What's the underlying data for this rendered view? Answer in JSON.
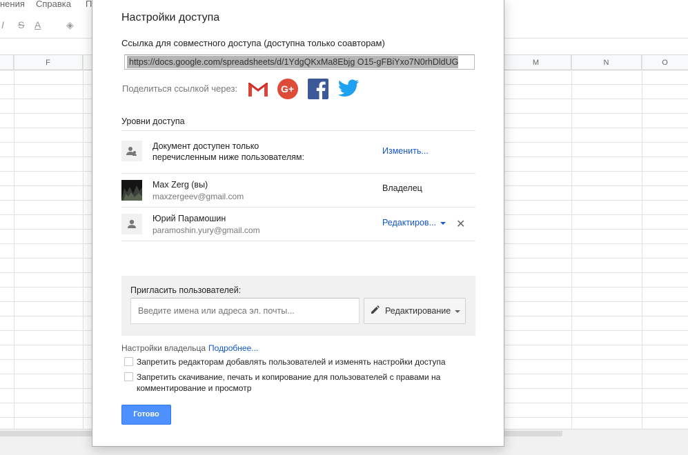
{
  "background": {
    "menu": [
      "нения",
      "Справка",
      "П"
    ],
    "columns": [
      "F",
      "M",
      "N",
      "O"
    ]
  },
  "dialog": {
    "title": "Настройки доступа",
    "link_label": "Ссылка для совместного доступа (доступна только соавторам)",
    "link_value": "https://docs.google.com/spreadsheets/d/1YdgQKxMa8Ebjg O15-gFBiYxo7N0rhDldUG",
    "share_label": "Поделиться ссылкой через:",
    "share_services": [
      "Gmail",
      "Google+",
      "Facebook",
      "Twitter"
    ],
    "access_title": "Уровни доступа",
    "access_rows": [
      {
        "text_line1": "Документ доступен только",
        "text_line2": "перечисленным ниже пользователям:",
        "action": "Изменить..."
      },
      {
        "name": "Max Zerg (вы)",
        "email": "maxzergeev@gmail.com",
        "role": "Владелец"
      },
      {
        "name": "Юрий Парамошин",
        "email": "paramoshin.yury@gmail.com",
        "role": "Редактиров..."
      }
    ],
    "invite": {
      "label": "Пригласить пользователей:",
      "placeholder": "Введите имена или адреса эл. почты...",
      "permission": "Редактирование"
    },
    "owner_settings": {
      "label": "Настройки владельца",
      "more_link": "Подробнее...",
      "option1": "Запретить редакторам добавлять пользователей и изменять настройки доступа",
      "option2_line1": "Запретить скачивание, печать и копирование для пользователей с правами на",
      "option2_line2": "комментирование и просмотр"
    },
    "done_label": "Готово"
  },
  "colors": {
    "link": "#1155cc",
    "primary_button": "#4d90fe",
    "gmail_red": "#db4437",
    "gplus_red": "#dd4b39",
    "facebook_blue": "#3b5998",
    "twitter_blue": "#1da1f2"
  }
}
